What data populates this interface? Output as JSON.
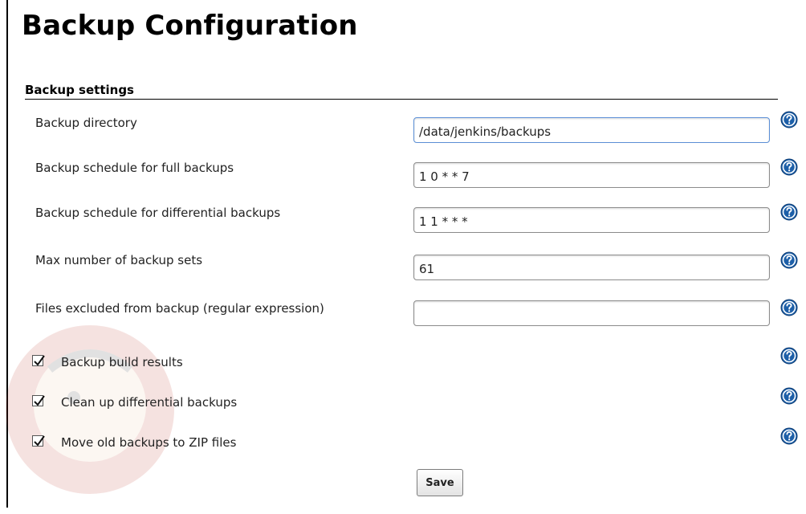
{
  "page": {
    "title": "Backup Configuration"
  },
  "section": {
    "title": "Backup settings"
  },
  "fields": [
    {
      "label": "Backup directory",
      "value": "/data/jenkins/backups"
    },
    {
      "label": "Backup schedule for full backups",
      "value": "1 0 * * 7"
    },
    {
      "label": "Backup schedule for differential backups",
      "value": "1 1 * * *"
    },
    {
      "label": "Max number of backup sets",
      "value": "61"
    },
    {
      "label": "Files excluded from backup (regular expression)",
      "value": ""
    }
  ],
  "checkboxes": [
    {
      "label": "Backup build results",
      "checked": true
    },
    {
      "label": "Clean up differential backups",
      "checked": true
    },
    {
      "label": "Move old backups to ZIP files",
      "checked": true
    }
  ],
  "actions": {
    "save_label": "Save"
  },
  "icons": {
    "help": "help-question-icon",
    "checkbox_mark": "checkmark-icon"
  },
  "colors": {
    "help_icon": "#1d5fa8",
    "watermark": "#c0392b"
  }
}
